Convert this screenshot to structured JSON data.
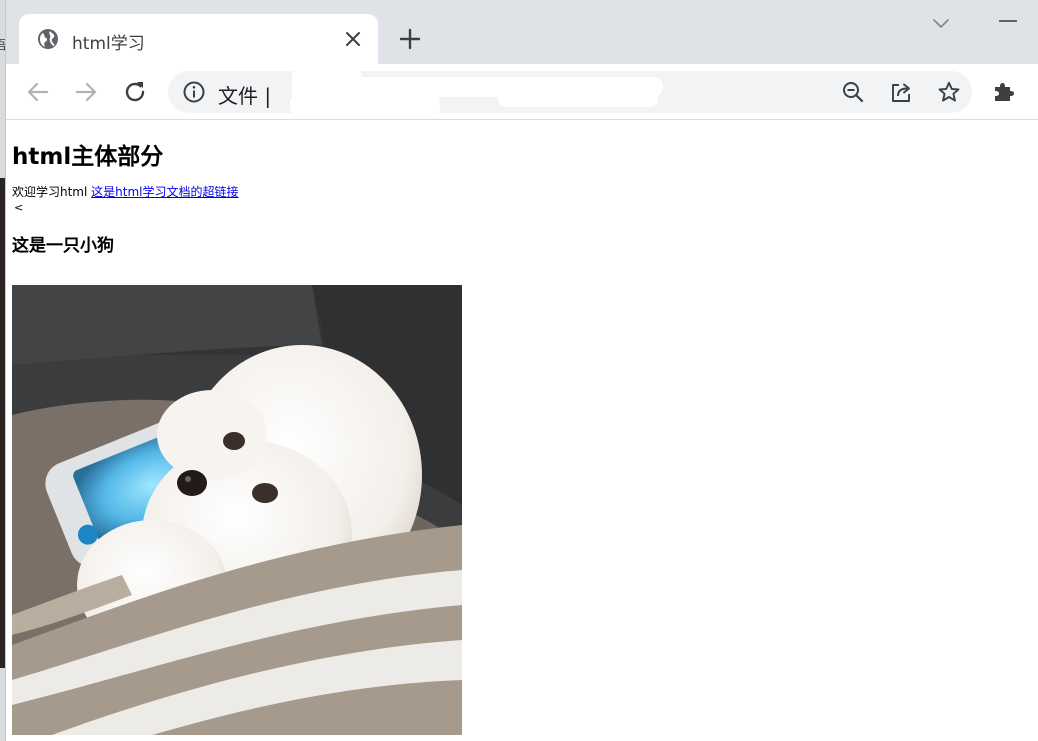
{
  "browser": {
    "tab_title": "html学习",
    "address_text": "文件 |",
    "tab_icons": {
      "favicon": "globe-icon",
      "close": "close-icon",
      "new_tab": "plus-icon",
      "tab_search": "chevron-down-icon",
      "minimize": "minimize-icon"
    },
    "toolbar_icons": [
      "back-arrow-icon",
      "forward-arrow-icon",
      "reload-icon",
      "info-icon",
      "zoom-out-icon",
      "share-icon",
      "star-icon",
      "extensions-puzzle-icon"
    ],
    "colors": {
      "tabstrip": "#dfe3e7",
      "omnibox": "#f1f3f4",
      "icon": "#5f6368",
      "link": "#0000ee"
    }
  },
  "page": {
    "heading": "html主体部分",
    "intro_text": "欢迎学习html",
    "link_text": "这是html学习文档的超链接",
    "stray_char": "<",
    "subheading": "这是一只小狗",
    "image_subject": "white bichon puppy holding a handheld game console"
  }
}
